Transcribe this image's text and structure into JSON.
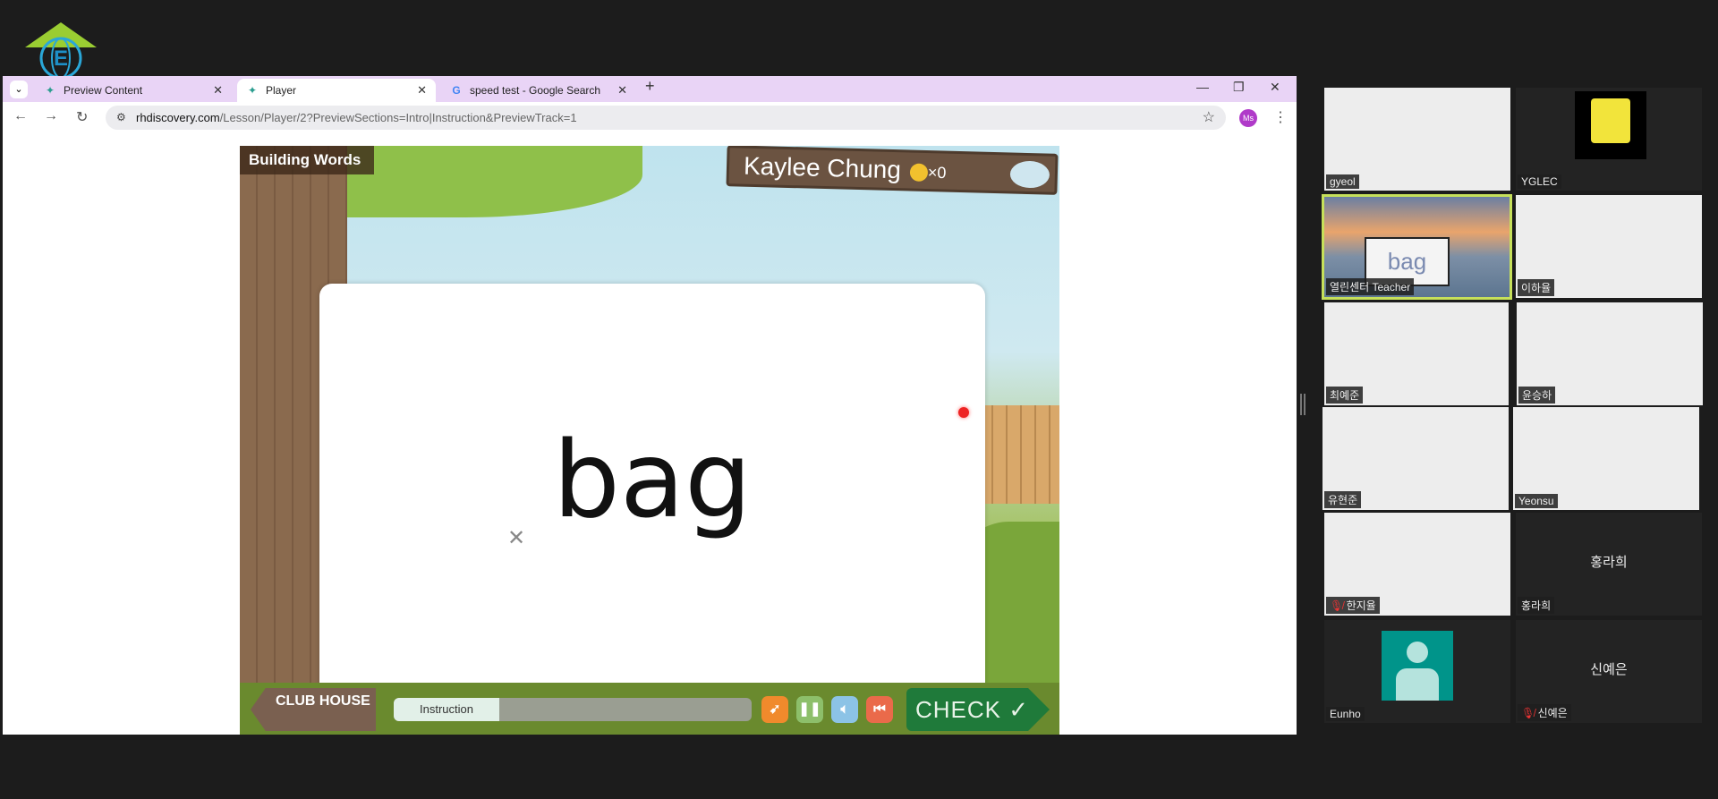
{
  "browser": {
    "tabs": [
      {
        "label": "Preview Content",
        "icon": "butterfly-icon"
      },
      {
        "label": "Player",
        "icon": "butterfly-icon",
        "active": true
      },
      {
        "label": "speed test - Google Search",
        "icon": "google-icon"
      }
    ],
    "url_host": "rhdiscovery.com",
    "url_path": "/Lesson/Player/2?PreviewSections=Intro|Instruction&PreviewTrack=1",
    "profile": "Ms"
  },
  "game": {
    "section_title": "Building Words",
    "player_name": "Kaylee Chung",
    "coin_count": "×0",
    "word": "bag",
    "club_house": "CLUB HOUSE",
    "progress_label": "Instruction",
    "check_label": "CHECK ✓"
  },
  "participants": [
    {
      "name": "gyeol",
      "muted": false
    },
    {
      "name": "YGLEC",
      "muted": false
    },
    {
      "name": "열린센터 Teacher",
      "muted": false,
      "active": true
    },
    {
      "name": "이하율",
      "muted": false
    },
    {
      "name": "최예준",
      "muted": false
    },
    {
      "name": "윤승하",
      "muted": false
    },
    {
      "name": "유현준",
      "muted": false
    },
    {
      "name": "Yeonsu",
      "muted": false
    },
    {
      "name": "한지율",
      "muted": true
    },
    {
      "name": "홍라희",
      "muted": false,
      "center_label": "홍라희"
    },
    {
      "name": "Eunho",
      "muted": false
    },
    {
      "name": "신예은",
      "muted": true,
      "center_label": "신예은"
    }
  ],
  "colors": {
    "tabbar": "#e9d4f6",
    "active_speaker": "#c6e05a",
    "check": "#1f7a3a"
  }
}
